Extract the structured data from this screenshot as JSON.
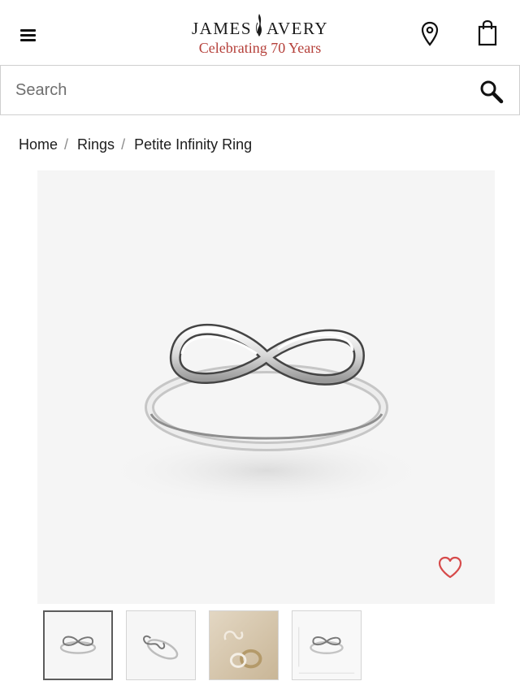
{
  "header": {
    "brand_left": "JAMES",
    "brand_right": "AVERY",
    "tagline": "Celebrating 70 Years",
    "icons": [
      "menu-icon",
      "location-pin-icon",
      "shopping-bag-icon"
    ]
  },
  "search": {
    "placeholder": "Search",
    "value": "",
    "icon": "search-icon"
  },
  "breadcrumb": {
    "items": [
      "Home",
      "Rings",
      "Petite Infinity Ring"
    ],
    "separator": "/"
  },
  "product": {
    "image_alt": "Petite Infinity Ring",
    "favorite_icon": "heart-outline-icon"
  },
  "colors": {
    "brand_red": "#b5403a",
    "heart": "#d64a4a",
    "image_bg": "#f5f5f5"
  }
}
